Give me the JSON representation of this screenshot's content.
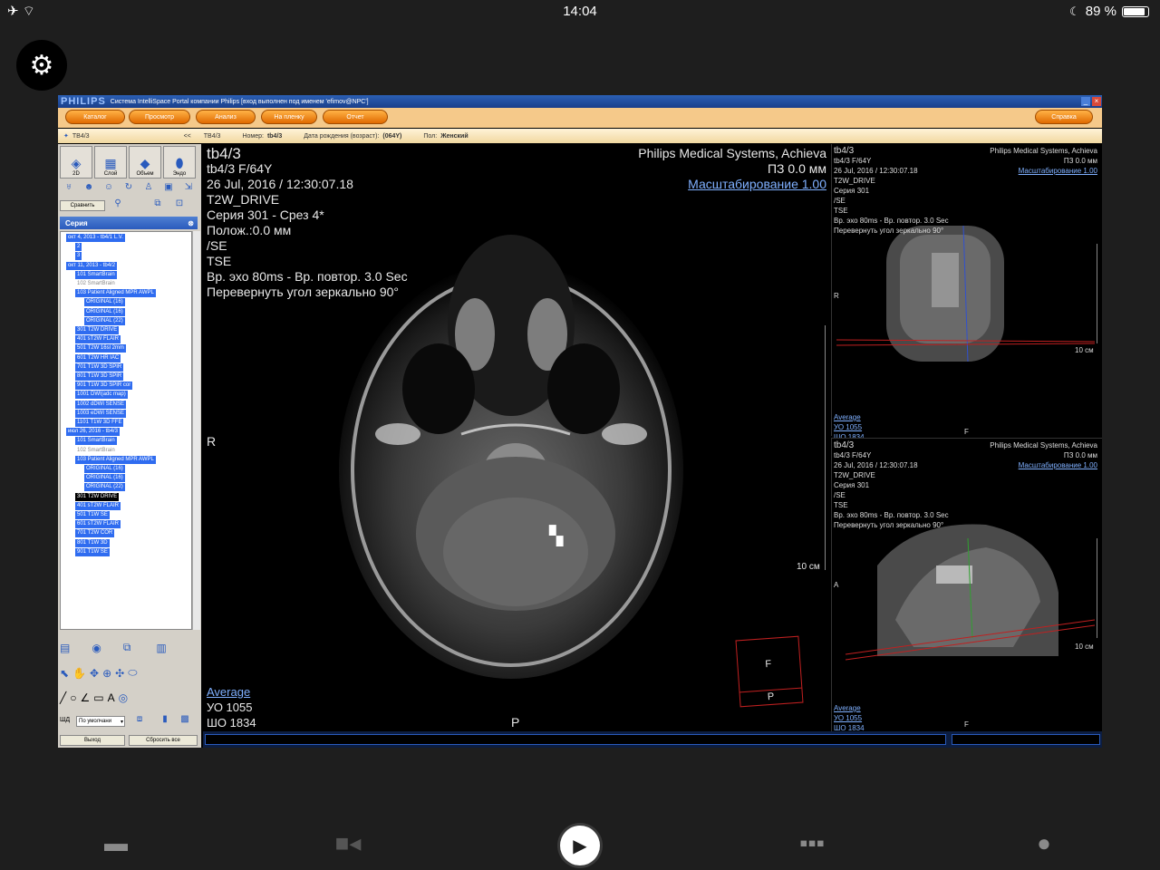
{
  "status_bar": {
    "time": "14:04",
    "battery": "89 %",
    "battery_level": 0.89
  },
  "icons": {
    "airplane": "airplane-icon",
    "wifi": "wifi-icon",
    "moon": "moon-icon",
    "gear": "gear-icon"
  },
  "app": {
    "logo": "PHILIPS",
    "title": "Система IntelliSpace Portal компании Philips [вход выполнен под именем 'efimov@NPC']",
    "menu": [
      "Каталог",
      "Просмотр",
      "Анализ",
      "На пленку",
      "Отчет"
    ],
    "help_button": "Справка",
    "info": {
      "tab": "TB4/3",
      "collapse": "<<",
      "patient_id": "TB4/3",
      "number_label": "Номер:",
      "number_value": "tb4/3",
      "dob_label": "Дата рождения (возраст):",
      "dob_value": "(064Y)",
      "sex_label": "Пол:",
      "sex_value": "Женский"
    }
  },
  "left_panel": {
    "views": [
      "2D",
      "Слой",
      "Объем",
      "Эндо"
    ],
    "compare_button": "Сравнить",
    "series_header": "Серия",
    "tree": [
      {
        "text": "окт 4, 2013 - tb4/1 L.V.",
        "cls": "sel"
      },
      {
        "text": "2",
        "cls": "sel"
      },
      {
        "text": "3",
        "cls": "sel"
      },
      {
        "text": "окт 11, 2013 - tb4/2",
        "cls": "sel"
      },
      {
        "text": "101 SmartBrain",
        "cls": "sel"
      },
      {
        "text": "102 SmartBrain",
        "cls": "grey"
      },
      {
        "text": "103 Patient Aligned MPR AWPL",
        "cls": "sel"
      },
      {
        "text": "ORIGINAL (16)",
        "cls": "sel"
      },
      {
        "text": "ORIGINAL (16)",
        "cls": "sel"
      },
      {
        "text": "ORIGINAL (22)",
        "cls": "sel"
      },
      {
        "text": "301 T2W DRIVE",
        "cls": "sel"
      },
      {
        "text": "401 sT2W FLAIR",
        "cls": "sel"
      },
      {
        "text": "501 T2W 16sl 2mm",
        "cls": "sel"
      },
      {
        "text": "601 T2W HR IAC",
        "cls": "sel"
      },
      {
        "text": "701 T1W 3D SPIR",
        "cls": "sel"
      },
      {
        "text": "801 T1W 3D SPIR",
        "cls": "sel"
      },
      {
        "text": "901 T1W 3D SPIR cor",
        "cls": "sel"
      },
      {
        "text": "1001 DWI(adc map)",
        "cls": "sel"
      },
      {
        "text": "1002 dDWI SENSE",
        "cls": "sel"
      },
      {
        "text": "1003 eDWI SENSE",
        "cls": "sel"
      },
      {
        "text": "1101 T1W 3D FFE",
        "cls": "sel"
      },
      {
        "text": "июл 26, 2016 - tb4/3",
        "cls": "sel"
      },
      {
        "text": "101 SmartBrain",
        "cls": "sel"
      },
      {
        "text": "102 SmartBrain",
        "cls": "grey"
      },
      {
        "text": "103 Patient Aligned MPR AWPL",
        "cls": "sel"
      },
      {
        "text": "ORIGINAL (16)",
        "cls": "sel"
      },
      {
        "text": "ORIGINAL (16)",
        "cls": "sel"
      },
      {
        "text": "ORIGINAL (22)",
        "cls": "sel"
      },
      {
        "text": "301 T2W DRIVE",
        "cls": "dark"
      },
      {
        "text": "401 sT2W FLAIR",
        "cls": "sel"
      },
      {
        "text": "501 T1W SE",
        "cls": "sel"
      },
      {
        "text": "601 sT2W FLAIR",
        "cls": "sel"
      },
      {
        "text": "701 T2W COR",
        "cls": "sel"
      },
      {
        "text": "801 T1W 3D",
        "cls": "sel"
      },
      {
        "text": "901 T1W SE",
        "cls": "sel"
      }
    ],
    "shd_label": "ШД",
    "preset_select": "По умолчани",
    "exit_button": "Выход",
    "reset_button": "Сбросить все"
  },
  "main_view": {
    "overlay_left": [
      "tb4/3",
      "tb4/3 F/64Y",
      "26 Jul, 2016 / 12:30:07.18",
      "T2W_DRIVE",
      "Серия 301 - Срез 4*",
      "Полож.:0.0 мм",
      "/SE",
      "TSE",
      "Вр. эхо  80ms - Вр. повтор. 3.0 Sec",
      "Перевернуть угол зеркально 90°"
    ],
    "vendor": "Philips Medical Systems, Achieva",
    "slice_pos": "ПЗ 0.0 мм",
    "zoom_link": "Масштабирование 1.00",
    "orient_r": "R",
    "orient_p": "P",
    "scale": "10 см",
    "cube_f": "F",
    "cube_p": "P",
    "average": "Average",
    "wl": "УО   1055",
    "ww": "ШО  1834"
  },
  "side_top": {
    "overlay_left": [
      "tb4/3",
      "tb4/3 F/64Y",
      "26 Jul, 2016 / 12:30:07.18",
      "T2W_DRIVE",
      "Серия 301",
      "/SE",
      "TSE",
      "Вр. эхо  80ms - Вр. повтор. 3.0 Sec",
      "Перевернуть угол зеркально 90°"
    ],
    "vendor": "Philips Medical Systems, Achieva",
    "slice_pos": "ПЗ 0.0 мм",
    "zoom_link": "Масштабирование 1.00",
    "orient_r": "R",
    "orient_f": "F",
    "scale": "10 см",
    "average": "Average",
    "wl": "УО   1055",
    "ww": "ШО  1834"
  },
  "side_bottom": {
    "overlay_left": [
      "tb4/3",
      "tb4/3 F/64Y",
      "26 Jul, 2016 / 12:30:07.18",
      "T2W_DRIVE",
      "Серия 301",
      "/SE",
      "TSE",
      "Вр. эхо  80ms - Вр. повтор. 3.0 Sec",
      "Перевернуть угол зеркально 90°"
    ],
    "vendor": "Philips Medical Systems, Achieva",
    "slice_pos": "ПЗ 0.0 мм",
    "zoom_link": "Масштабирование 1.00",
    "orient_a": "A",
    "orient_f": "F",
    "scale": "10 см",
    "average": "Average",
    "wl": "УО   1055",
    "ww": "ШО  1834"
  },
  "bottom_nav": [
    "folder-icon",
    "video-icon",
    "play-icon",
    "chat-icon",
    "person-icon"
  ]
}
